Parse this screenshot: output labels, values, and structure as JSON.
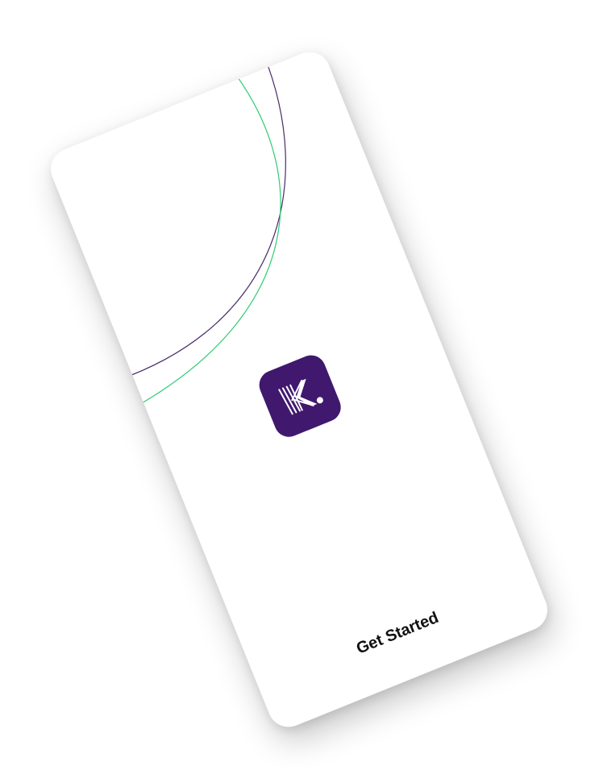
{
  "app": {
    "logo_icon": "brand-k-logo-icon",
    "logo_color": "#40186e",
    "cta_label": "Get Started",
    "arc_colors": {
      "green": "#2ecc71",
      "purple": "#4a2a6a"
    }
  }
}
